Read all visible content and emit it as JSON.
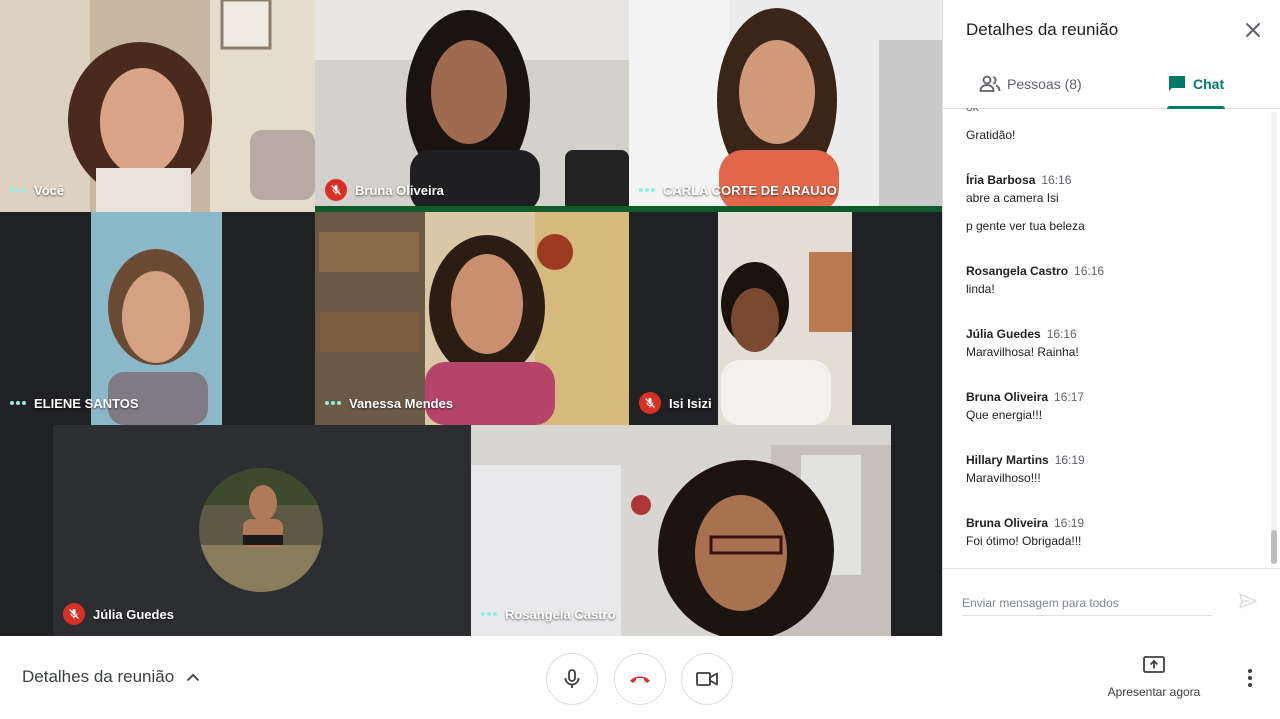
{
  "tiles": [
    {
      "name": "Você",
      "muted": false
    },
    {
      "name": "Bruna Oliveira",
      "muted": true
    },
    {
      "name": "CARLA CORTE DE ARAUJO",
      "muted": false
    },
    {
      "name": "ELIENE SANTOS",
      "muted": false
    },
    {
      "name": "Vanessa Mendes",
      "muted": false
    },
    {
      "name": "Isi Isizi",
      "muted": true
    },
    {
      "name": "Júlia Guedes",
      "muted": true
    },
    {
      "name": "Rosangela Castro",
      "muted": false
    }
  ],
  "panel": {
    "title": "Detalhes da reunião",
    "tab_people": "Pessoas (8)",
    "tab_chat": "Chat",
    "partial_message": "ok",
    "messages": [
      {
        "text": "Gratidão!"
      },
      {
        "sender": "Íria Barbosa",
        "time": "16:16",
        "text": "abre a camera Isi"
      },
      {
        "text": "p gente ver tua beleza"
      },
      {
        "sender": "Rosangela Castro",
        "time": "16:16",
        "text": "linda!"
      },
      {
        "sender": "Júlia Guedes",
        "time": "16:16",
        "text": "Maravilhosa! Rainha!"
      },
      {
        "sender": "Bruna Oliveira",
        "time": "16:17",
        "text": "Que energia!!!"
      },
      {
        "sender": "Hillary Martins",
        "time": "16:19",
        "text": "Maravilhoso!!!"
      },
      {
        "sender": "Bruna Oliveira",
        "time": "16:19",
        "text": "Foi ótimo! Obrigada!!!"
      }
    ],
    "composer_placeholder": "Enviar mensagem para todos"
  },
  "bottom_bar": {
    "meeting_details": "Detalhes da reunião",
    "present_label": "Apresentar agora"
  },
  "colors": {
    "accent": "#00796b",
    "hangup": "#d93025",
    "dark_bg": "#202124"
  }
}
